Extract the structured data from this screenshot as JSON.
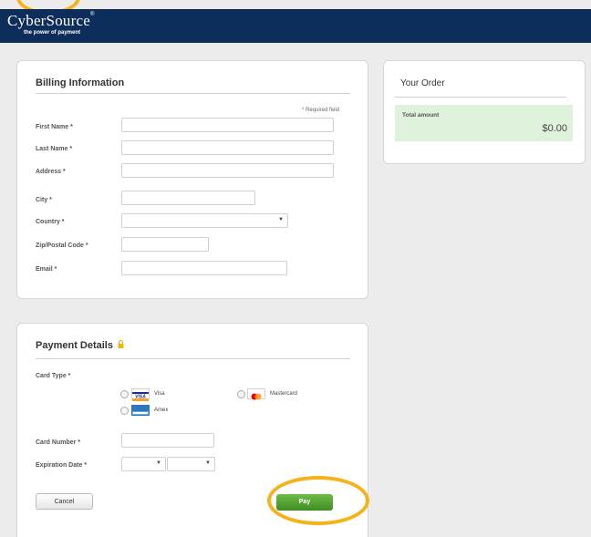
{
  "brand": {
    "name": "CyberSource",
    "tagline": "the power of payment"
  },
  "billing": {
    "title": "Billing Information",
    "required_note": "* Required field",
    "fields": {
      "first_name": "First Name *",
      "last_name": "Last Name *",
      "address": "Address *",
      "city": "City *",
      "country": "Country *",
      "zip": "Zip/Postal Code *",
      "email": "Email *"
    },
    "country_arrow": "▼"
  },
  "order": {
    "title": "Your Order",
    "total_label": "Total amount",
    "total_value": "$0.00"
  },
  "payment": {
    "title": "Payment Details",
    "card_type_label": "Card Type *",
    "cards": {
      "visa": "Visa",
      "mastercard": "Mastercard",
      "amex": "Amex"
    },
    "card_number_label": "Card Number *",
    "expiration_label": "Expiration Date *",
    "arrow": "▼",
    "cancel_label": "Cancel",
    "pay_label": "Pay"
  },
  "icons": {
    "lock": "lock-icon",
    "visa": "visa-logo-icon",
    "mastercard": "mastercard-logo-icon",
    "amex": "amex-logo-icon"
  },
  "colors": {
    "header": "#0d2e5a",
    "highlight_ring": "#f5b21a",
    "pay_button": "#4f9f2c",
    "total_bg": "#dff2dc"
  }
}
